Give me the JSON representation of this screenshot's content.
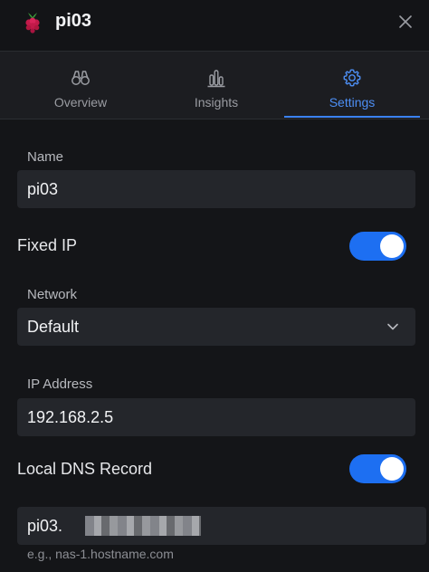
{
  "header": {
    "title": "pi03",
    "logo_icon": "raspberry-pi-icon",
    "close_icon": "close-icon"
  },
  "tabs": [
    {
      "label": "Overview",
      "icon": "binoculars-icon",
      "active": false
    },
    {
      "label": "Insights",
      "icon": "bar-chart-icon",
      "active": false
    },
    {
      "label": "Settings",
      "icon": "gear-icon",
      "active": true
    }
  ],
  "form": {
    "name_label": "Name",
    "name_value": "pi03",
    "fixed_ip_label": "Fixed IP",
    "fixed_ip_enabled": true,
    "network_label": "Network",
    "network_value": "Default",
    "ip_label": "IP Address",
    "ip_value": "192.168.2.5",
    "dns_label": "Local DNS Record",
    "dns_enabled": true,
    "dns_value_prefix": "pi03.",
    "dns_hint": "e.g., nas-1.hostname.com"
  },
  "colors": {
    "accent": "#3b82f6",
    "toggle_on": "#1d6ff2",
    "background": "#141518",
    "field_bg": "#24262b"
  }
}
